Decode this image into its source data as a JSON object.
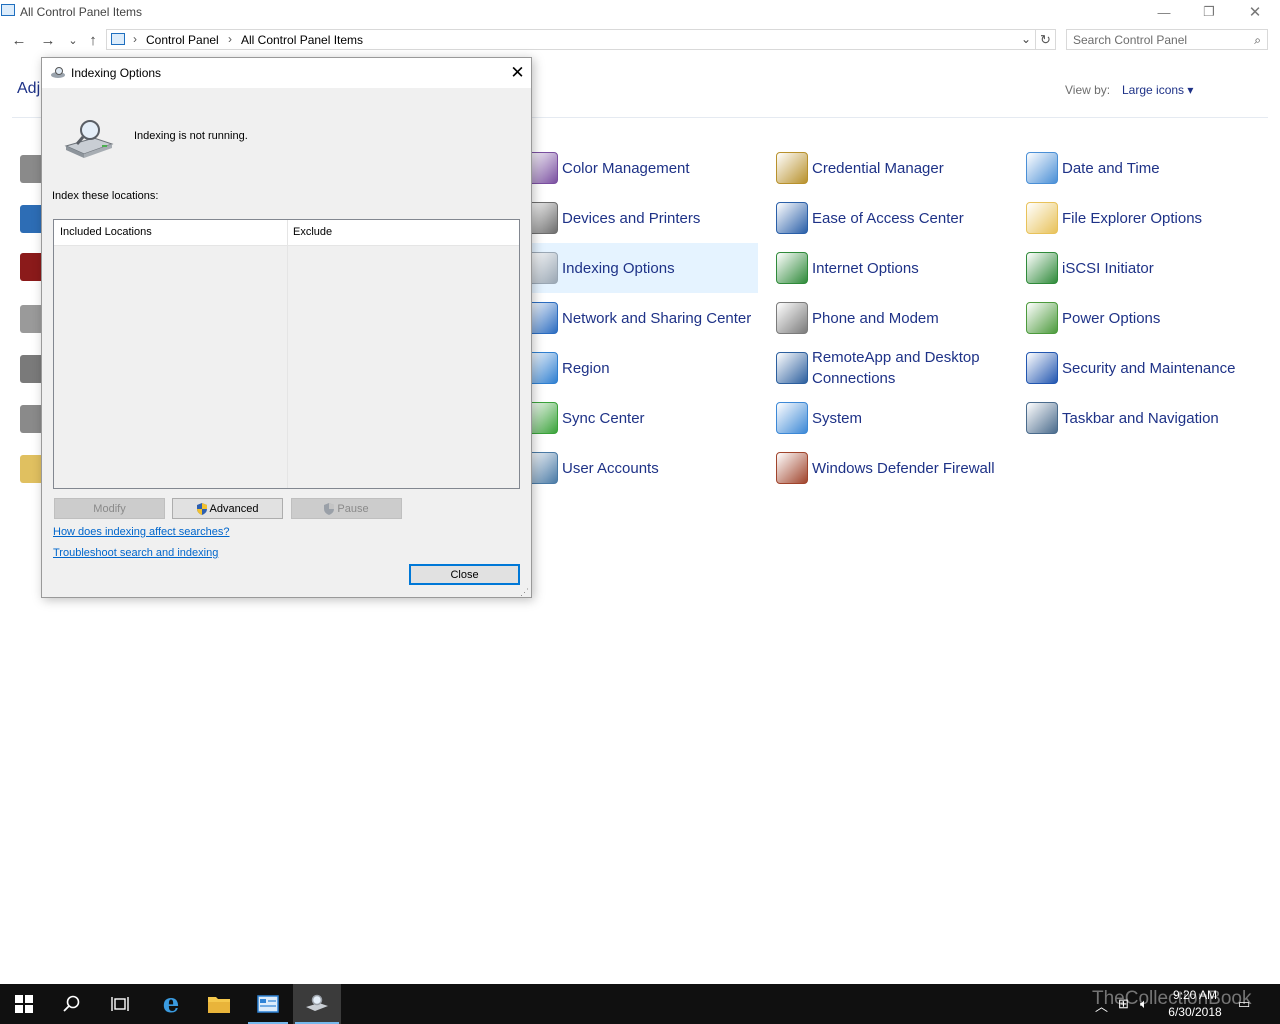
{
  "window": {
    "title": "All Control Panel Items",
    "minimize": "—",
    "restore": "❐",
    "close": "✕"
  },
  "nav": {
    "back": "←",
    "forward": "→",
    "recent": "⌄",
    "up": "↑",
    "breadcrumb": [
      "Control Panel",
      "All Control Panel Items"
    ],
    "dropdown": "⌄",
    "refresh": "↻"
  },
  "search": {
    "placeholder": "Search Control Panel",
    "icon": "⌕"
  },
  "header": {
    "adjust_partial": "Adj",
    "view_by_label": "View by:",
    "view_by_value": "Large icons ▾"
  },
  "items": {
    "col1": [
      {
        "label": "Color Management",
        "icon": "color-management-icon",
        "color": "#7a4fa0"
      },
      {
        "label": "Devices and Printers",
        "icon": "printer-icon",
        "color": "#6d6d6d"
      },
      {
        "label": "Indexing Options",
        "icon": "indexing-icon",
        "color": "#9aa7b4",
        "highlighted": true
      },
      {
        "label": "Network and Sharing Center",
        "icon": "network-icon",
        "color": "#2b6cc0"
      },
      {
        "label": "Region",
        "icon": "globe-icon",
        "color": "#2f7fd0"
      },
      {
        "label": "Sync Center",
        "icon": "sync-icon",
        "color": "#3aa23a"
      },
      {
        "label": "User Accounts",
        "icon": "user-icon",
        "color": "#4a7aa5"
      }
    ],
    "col2": [
      {
        "label": "Credential Manager",
        "icon": "credential-icon",
        "color": "#b8912c"
      },
      {
        "label": "Ease of Access Center",
        "icon": "accessibility-icon",
        "color": "#2a5fa8"
      },
      {
        "label": "Internet Options",
        "icon": "internet-icon",
        "color": "#2f8a3a"
      },
      {
        "label": "Phone and Modem",
        "icon": "phone-icon",
        "color": "#7b7b7b"
      },
      {
        "label": "RemoteApp and Desktop Connections",
        "icon": "remote-desktop-icon",
        "color": "#2c5f9e"
      },
      {
        "label": "System",
        "icon": "monitor-icon",
        "color": "#3c88d6"
      },
      {
        "label": "Windows Defender Firewall",
        "icon": "firewall-icon",
        "color": "#a0442c"
      }
    ],
    "col3": [
      {
        "label": "Date and Time",
        "icon": "calendar-icon",
        "color": "#4a8fd6"
      },
      {
        "label": "File Explorer Options",
        "icon": "folder-options-icon",
        "color": "#e8c25a"
      },
      {
        "label": "iSCSI Initiator",
        "icon": "iscsi-icon",
        "color": "#2f8a3a"
      },
      {
        "label": "Power Options",
        "icon": "power-icon",
        "color": "#4c9a3c"
      },
      {
        "label": "Security and Maintenance",
        "icon": "flag-icon",
        "color": "#2256b0"
      },
      {
        "label": "Taskbar and Navigation",
        "icon": "taskbar-icon",
        "color": "#4a6b8c"
      }
    ]
  },
  "left_icons": [
    "#8a8a8a",
    "#2d6db5",
    "#8b1a1a",
    "#9a9a9a",
    "#7a7a7a",
    "#8a8a8a",
    "#e0c060"
  ],
  "dialog": {
    "title": "Indexing Options",
    "close_glyph": "✕",
    "status": "Indexing is not running.",
    "index_label": "Index these locations:",
    "columns": [
      "Included Locations",
      "Exclude"
    ],
    "buttons": {
      "modify": "Modify",
      "advanced": "Advanced",
      "pause": "Pause",
      "close": "Close"
    },
    "links": [
      "How does indexing affect searches?",
      "Troubleshoot search and indexing"
    ]
  },
  "taskbar": {
    "time": "9:20 AM",
    "date": "6/30/2018",
    "watermark": "TheCollectionBook",
    "accent": "#76b9ed"
  }
}
